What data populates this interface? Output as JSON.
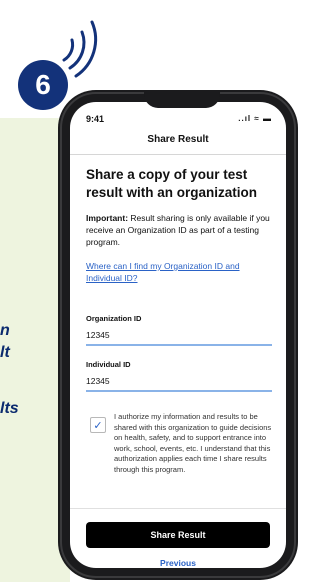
{
  "step": {
    "number": "6"
  },
  "left_fragments": [
    "n",
    "lt",
    "lts"
  ],
  "status": {
    "time": "9:41",
    "icons": "..ıl ≈ ▬"
  },
  "nav": {
    "title": "Share Result"
  },
  "main": {
    "heading": "Share a copy of your test result with an organization",
    "notice_bold": "Important:",
    "notice_text": " Result sharing is only available if you receive an Organization ID as part of a testing program.",
    "help_link": "Where can I find my Organization ID and Individual ID?",
    "org_id_label": "Organization ID",
    "org_id_value": "12345",
    "individual_id_label": "Individual ID",
    "individual_id_value": "12345",
    "consent_text": "I authorize my information and results to be shared with this organization to guide decisions on health, safety, and to support entrance into work, school, events, etc. I understand that this authorization applies each time I share results through this program.",
    "consent_checked": true
  },
  "actions": {
    "share_label": "Share Result",
    "previous_label": "Previous"
  }
}
